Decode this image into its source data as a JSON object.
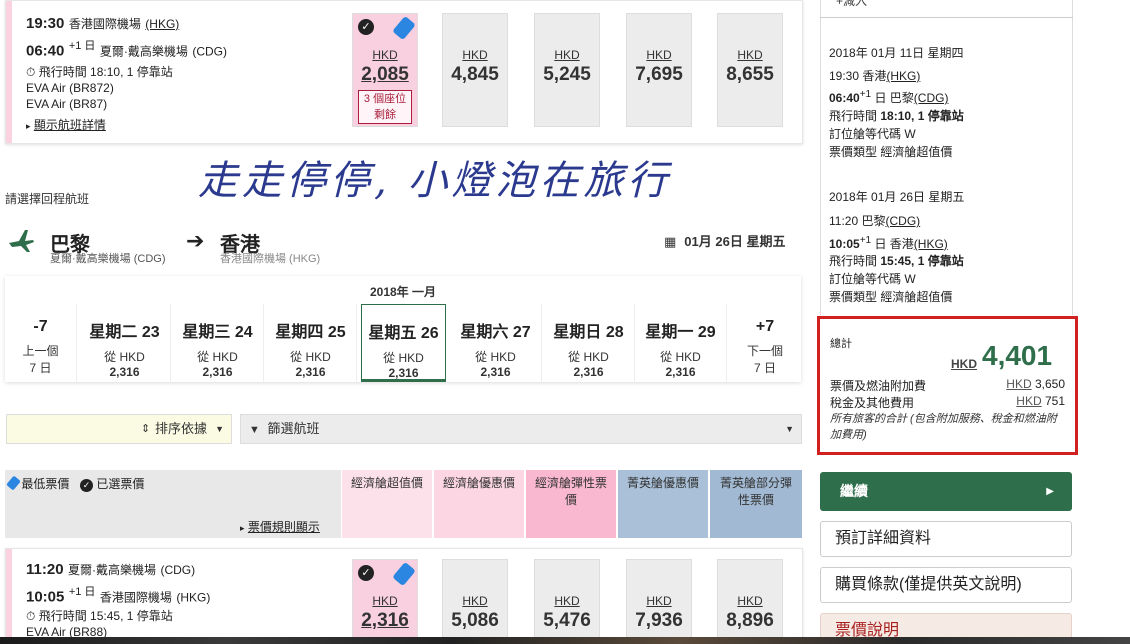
{
  "outbound": {
    "dep_time": "19:30",
    "dep_airport": "香港國際機場",
    "dep_code": "(HKG)",
    "arr_time": "06:40",
    "arr_plus": "+1 日",
    "arr_airport": "夏爾·戴高樂機場",
    "arr_code": "(CDG)",
    "duration": "飛行時間 18:10, 1 停靠站",
    "airline1": "EVA Air (BR872)",
    "airline2": "EVA Air (BR87)",
    "details_link": "顯示航班詳情",
    "fares": [
      {
        "cur": "HKD",
        "amount": "2,085",
        "seats": "3 個座位剩餘"
      },
      {
        "cur": "HKD",
        "amount": "4,845"
      },
      {
        "cur": "HKD",
        "amount": "5,245"
      },
      {
        "cur": "HKD",
        "amount": "7,695"
      },
      {
        "cur": "HKD",
        "amount": "8,655"
      }
    ]
  },
  "watermark": "走走停停, 小燈泡在旅行",
  "return_label": "請選擇回程航班",
  "route": {
    "from_city": "巴黎",
    "from_airport": "夏爾·戴高樂機場 (CDG)",
    "to_city": "香港",
    "to_airport": "香港國際機場 (HKG)",
    "date": "01月 26日 星期五"
  },
  "calendar": {
    "month": "2018年 一月",
    "prev": {
      "label": "-7",
      "sub1": "上一個",
      "sub2": "7 日"
    },
    "next": {
      "label": "+7",
      "sub1": "下一個",
      "sub2": "7 日"
    },
    "days": [
      {
        "name": "星期二 23",
        "from": "從 HKD",
        "price": "2,316"
      },
      {
        "name": "星期三 24",
        "from": "從 HKD",
        "price": "2,316"
      },
      {
        "name": "星期四 25",
        "from": "從 HKD",
        "price": "2,316"
      },
      {
        "name": "星期五 26",
        "from": "從 HKD",
        "price": "2,316"
      },
      {
        "name": "星期六 27",
        "from": "從 HKD",
        "price": "2,316"
      },
      {
        "name": "星期日 28",
        "from": "從 HKD",
        "price": "2,316"
      },
      {
        "name": "星期一 29",
        "from": "從 HKD",
        "price": "2,316"
      }
    ]
  },
  "filters": {
    "sort_label": "排序依據",
    "filter_label": "篩選航班"
  },
  "legend": {
    "lowest": "最低票價",
    "selected": "已選票價",
    "rules_link": "票價規則顯示"
  },
  "fare_columns": [
    {
      "label": "經濟艙超值價",
      "color": "#fde1ea"
    },
    {
      "label": "經濟艙優惠價",
      "color": "#fcd7e3"
    },
    {
      "label": "經濟艙彈性票價",
      "color": "#f9b8cf"
    },
    {
      "label": "菁英艙優惠價",
      "color": "#a9c0d8"
    },
    {
      "label": "菁英艙部分彈性票價",
      "color": "#a1b9d2"
    }
  ],
  "inbound": {
    "dep_time": "11:20",
    "dep_airport": "夏爾·戴高樂機場",
    "dep_code": "(CDG)",
    "arr_time": "10:05",
    "arr_plus": "+1 日",
    "arr_airport": "香港國際機場",
    "arr_code": "(HKG)",
    "duration": "飛行時間 15:45, 1 停靠站",
    "airline1": "EVA Air (BR88)",
    "fares": [
      {
        "cur": "HKD",
        "amount": "2,316"
      },
      {
        "cur": "HKD",
        "amount": "5,086"
      },
      {
        "cur": "HKD",
        "amount": "5,476"
      },
      {
        "cur": "HKD",
        "amount": "7,936"
      },
      {
        "cur": "HKD",
        "amount": "8,896"
      }
    ]
  },
  "summary": {
    "top_cut": "+減入",
    "seg1": {
      "date": "2018年 01月 11日 星期四",
      "dep": "19:30 香港",
      "dep_code": "(HKG)",
      "arr_time": "06:40",
      "arr_plus": "+1",
      "arr_place": "日 巴黎",
      "arr_code": "(CDG)",
      "duration_label": "飛行時間",
      "duration": "18:10, 1 停靠站",
      "class_code": "訂位艙等代碼 W",
      "fare_type": "票價類型 經濟艙超值價"
    },
    "seg2": {
      "date": "2018年 01月 26日 星期五",
      "dep": "11:20 巴黎",
      "dep_code": "(CDG)",
      "arr_time": "10:05",
      "arr_plus": "+1",
      "arr_place": "日 香港",
      "arr_code": "(HKG)",
      "duration_label": "飛行時間",
      "duration": "15:45, 1 停靠站",
      "class_code": "訂位艙等代碼 W",
      "fare_type": "票價類型 經濟艙超值價"
    },
    "total_label": "總計",
    "total_cur": "HKD",
    "total_amount": "4,401",
    "fare_fuel_label": "票價及燃油附加費",
    "fare_fuel_cur": "HKD",
    "fare_fuel_value": "3,650",
    "tax_label": "稅金及其他費用",
    "tax_cur": "HKD",
    "tax_value": "751",
    "note": "所有旅客的合計 (包含附加服務、稅金和燃油附加費用)",
    "continue_btn": "繼續",
    "booking_details_btn": "預訂詳細資料",
    "terms_btn": "購買條款(僅提供英文說明)",
    "fare_info_btn": "票價說明"
  },
  "colors": {
    "accent_green": "#2f6e4a",
    "highlight_red": "#d0201f",
    "selected_pink": "#f8d0df"
  }
}
